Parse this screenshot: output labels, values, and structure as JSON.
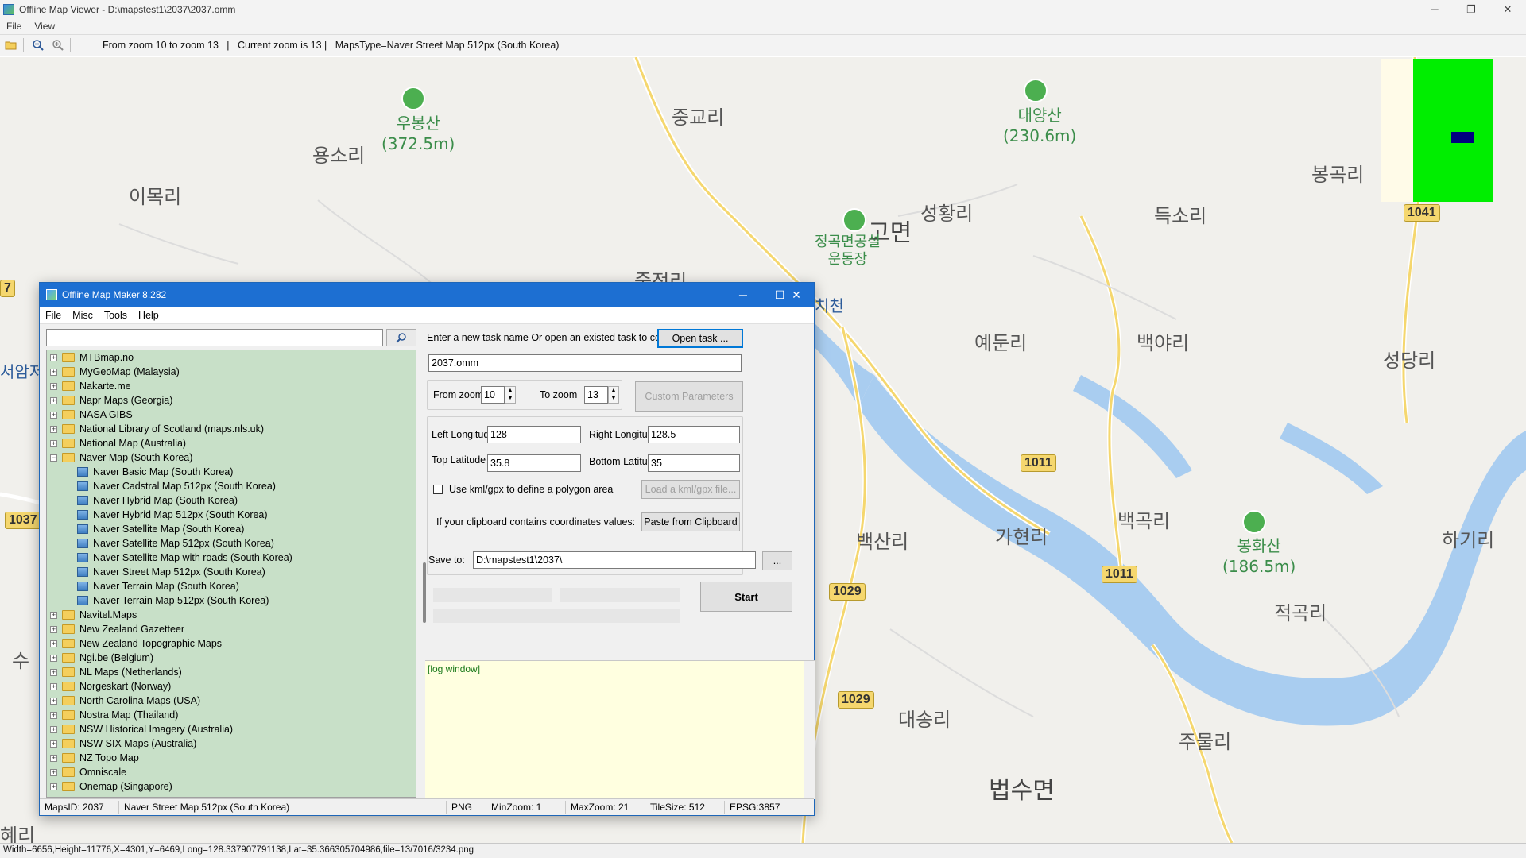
{
  "window": {
    "title": "Offline Map Viewer - D:\\mapstest1\\2037\\2037.omm",
    "controls": {
      "minimize": "─",
      "restore": "❐",
      "close": "✕"
    }
  },
  "menu": {
    "file": "File",
    "view": "View"
  },
  "toolbar": {
    "info": "From zoom 10 to zoom 13   |   Current zoom is 13 |   MapsType=Naver Street Map 512px (South Korea)"
  },
  "map": {
    "labels": {
      "l1": "우봉산\n(372.5m)",
      "l2": "용소리",
      "l3": "이목리",
      "l4": "중교리",
      "l5": "대양산\n(230.6m)",
      "l6": "봉곡리",
      "l7": "고면",
      "l8": "성황리",
      "l9": "득소리",
      "l10": "정곡면공설\n운동장",
      "l11": "죽전리",
      "l12": "치천",
      "l13": "예둔리",
      "l14": "백야리",
      "l15": "성당리",
      "l16": "가현리",
      "l17": "백곡리",
      "l18": "백산리",
      "l19": "봉화산\n(186.5m)",
      "l20": "하기리",
      "l21": "적곡리",
      "l22": "대송리",
      "l23": "주물리",
      "l24": "법수면",
      "l25": "서암저",
      "l26": "수",
      "l27": "혜리",
      "l28": "7"
    },
    "roads": {
      "r1041": "1041",
      "r1011a": "1011",
      "r1011b": "1011",
      "r1029a": "1029",
      "r1029b": "1029",
      "r1037": "1037"
    }
  },
  "statusbar": {
    "text": "Width=6656,Height=11776,X=4301,Y=6469,Long=128.337907791138,Lat=35.366305704986,file=13/7016/3234.png"
  },
  "dialog": {
    "title": "Offline Map Maker 8.282",
    "menu": [
      "File",
      "Misc",
      "Tools",
      "Help"
    ],
    "search": {
      "placeholder": "",
      "value": ""
    },
    "tree": [
      {
        "label": "MTBmap.no",
        "type": "folder"
      },
      {
        "label": "MyGeoMap (Malaysia)",
        "type": "folder"
      },
      {
        "label": "Nakarte.me",
        "type": "folder"
      },
      {
        "label": "Napr Maps (Georgia)",
        "type": "folder"
      },
      {
        "label": "NASA GIBS",
        "type": "folder"
      },
      {
        "label": "National Library of Scotland (maps.nls.uk)",
        "type": "folder"
      },
      {
        "label": "National Map (Australia)",
        "type": "folder"
      },
      {
        "label": "Naver Map (South Korea)",
        "type": "folder-open"
      },
      {
        "label": "Naver Basic Map (South Korea)",
        "type": "map"
      },
      {
        "label": "Naver Cadstral Map 512px (South Korea)",
        "type": "map"
      },
      {
        "label": "Naver Hybrid Map (South Korea)",
        "type": "map"
      },
      {
        "label": "Naver Hybrid Map 512px (South Korea)",
        "type": "map"
      },
      {
        "label": "Naver Satellite Map (South Korea)",
        "type": "map"
      },
      {
        "label": "Naver Satellite Map 512px (South Korea)",
        "type": "map"
      },
      {
        "label": "Naver Satellite Map with roads (South Korea)",
        "type": "map"
      },
      {
        "label": "Naver Street Map 512px (South Korea)",
        "type": "map"
      },
      {
        "label": "Naver Terrain Map (South Korea)",
        "type": "map"
      },
      {
        "label": "Naver Terrain Map 512px (South Korea)",
        "type": "map"
      },
      {
        "label": "Navitel.Maps",
        "type": "folder"
      },
      {
        "label": "New Zealand Gazetteer",
        "type": "folder"
      },
      {
        "label": "New Zealand Topographic Maps",
        "type": "folder"
      },
      {
        "label": "Ngi.be (Belgium)",
        "type": "folder"
      },
      {
        "label": "NL Maps (Netherlands)",
        "type": "folder"
      },
      {
        "label": "Norgeskart (Norway)",
        "type": "folder"
      },
      {
        "label": "North Carolina Maps (USA)",
        "type": "folder"
      },
      {
        "label": "Nostra Map (Thailand)",
        "type": "folder"
      },
      {
        "label": "NSW Historical Imagery (Australia)",
        "type": "folder"
      },
      {
        "label": "NSW SIX Maps (Australia)",
        "type": "folder"
      },
      {
        "label": "NZ Topo Map",
        "type": "folder"
      },
      {
        "label": "Omniscale",
        "type": "folder"
      },
      {
        "label": "Onemap (Singapore)",
        "type": "folder"
      }
    ],
    "task": {
      "prompt": "Enter a new task name Or open an existed task to continue:",
      "open_button": "Open task ...",
      "name_value": "2037.omm"
    },
    "zoom": {
      "from_label": "From zoom",
      "from_value": "10",
      "to_label": "To zoom",
      "to_value": "13",
      "custom_button": "Custom Parameters"
    },
    "coords": {
      "left_lon_label": "Left Longitude",
      "left_lon_value": "128",
      "right_lon_label": "Right Longitude",
      "right_lon_value": "128.5",
      "top_lat_label": "Top Latitude",
      "top_lat_value": "35.8",
      "bottom_lat_label": "Bottom Latitude",
      "bottom_lat_value": "35"
    },
    "kml": {
      "checkbox_label": "Use kml/gpx to define a polygon area",
      "load_button": "Load a kml/gpx file..."
    },
    "clipboard": {
      "label": "If your clipboard contains coordinates values:",
      "button": "Paste from Clipboard"
    },
    "save": {
      "label": "Save to:",
      "value": "D:\\mapstest1\\2037\\",
      "browse": "..."
    },
    "start_button": "Start",
    "log": "[log window]",
    "status": {
      "maps_id": "MapsID: 2037",
      "map_name": "Naver Street Map 512px (South Korea)",
      "format": "PNG",
      "min_zoom": "MinZoom: 1",
      "max_zoom": "MaxZoom: 21",
      "tile_size": "TileSize: 512",
      "epsg": "EPSG:3857"
    }
  }
}
